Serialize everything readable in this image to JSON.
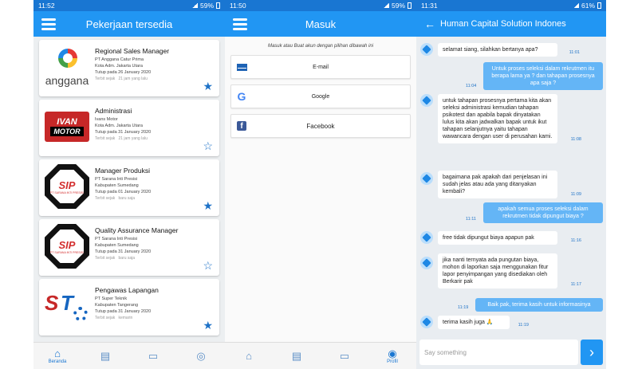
{
  "screen1": {
    "time": "11:52",
    "battery": "59%",
    "title": "Pekerjaan tersedia",
    "jobs": [
      {
        "title": "Regional Sales Manager",
        "company": "PT Anggana Catur Prima",
        "location": "Kota Adm. Jakarta Utara",
        "deadline": "Tutup pada 26 January 2020",
        "posted_label": "Terbit sejak",
        "posted": "21 jam yang lalu",
        "logo_text": "anggana",
        "starred": true
      },
      {
        "title": "Administrasi",
        "company": "Ivans Motor",
        "location": "Kota Adm. Jakarta Utara",
        "deadline": "Tutup pada 31 January 2020",
        "posted_label": "Terbit sejak",
        "posted": "21 jam yang lalu",
        "logo_text_1": "IVAN",
        "logo_text_2": "MOTOR",
        "starred": false
      },
      {
        "title": "Manager Produksi",
        "company": "PT Sarana Inti Presisi",
        "location": "Kabupaten Sumedang",
        "deadline": "Tutup pada 01 January 2020",
        "posted_label": "Terbit sejak",
        "posted": "baru saja",
        "logo_text_1": "SIP",
        "logo_text_2": "PT SARANA INTI PRESISI",
        "starred": true
      },
      {
        "title": "Quality Assurance Manager",
        "company": "PT Sarana Inti Presisi",
        "location": "Kabupaten Sumedang",
        "deadline": "Tutup pada 31 January 2020",
        "posted_label": "Terbit sejak",
        "posted": "baru saja",
        "logo_text_1": "SIP",
        "logo_text_2": "PT SARANA INTI PRESISI",
        "starred": false
      },
      {
        "title": "Pengawas Lapangan",
        "company": "PT Super Teknik",
        "location": "Kabupaten Tangerang",
        "deadline": "Tutup pada 31 January 2020",
        "posted_label": "Terbit sejak",
        "posted": "kemarin",
        "logo_text_1": "S",
        "logo_text_2": "T",
        "starred": true
      }
    ],
    "nav": {
      "home_label": "Beranda"
    }
  },
  "screen2": {
    "time": "11:50",
    "battery": "59%",
    "title": "Masuk",
    "hint": "Masuk atau Buat akun dengan pilihan dibawah ini",
    "buttons": {
      "email": "E-mail",
      "google": "Google",
      "facebook": "Facebook"
    },
    "nav": {
      "profile_label": "Profil"
    }
  },
  "screen3": {
    "time": "11:31",
    "battery": "61%",
    "title": "Human Capital Solution Indones",
    "messages": [
      {
        "dir": "in",
        "text": "selamat siang, silahkan bertanya apa?",
        "time": "11:01"
      },
      {
        "dir": "out",
        "text": "Untuk proses seleksi dalam rekrutmen itu berapa lama ya ? dan tahapan prosesnya apa saja ?",
        "time": "11:04"
      },
      {
        "dir": "in",
        "text": "untuk tahapan prosesnya pertama kita akan seleksi administrasi kemudian tahapan psikotest dan apabila bapak dinyatakan lulus kita akan  jadwalkan bapak untuk ikut tahapan selanjutnya yaitu tahapan wawancara dengan user di perusahan kami.",
        "time": "11:08"
      },
      {
        "dir": "in",
        "text": "bagaimana pak apakah dari penjelasan ini sudah jelas atau ada yang ditanyakan kembali?",
        "time": "11:09"
      },
      {
        "dir": "out",
        "text": "apakah semua proses seleksi dalam rekrutmen tidak dipungut biaya ?",
        "time": "11:11"
      },
      {
        "dir": "in",
        "text": "free tidak dipungut biaya apapun pak",
        "time": "11:16"
      },
      {
        "dir": "in",
        "text": "jika nanti ternyata ada pungutan biaya, mohon di laporkan saja menggunakan fitur lapor penyimpangan yang disediakan oleh Berkarir pak",
        "time": "11:17"
      },
      {
        "dir": "out",
        "text": "Baik pak, terima kasih untuk informasinya",
        "time": "11:19"
      },
      {
        "dir": "in",
        "text": "terima kasih juga 🙏",
        "time": "11:19"
      }
    ],
    "composer_placeholder": "Say something"
  }
}
